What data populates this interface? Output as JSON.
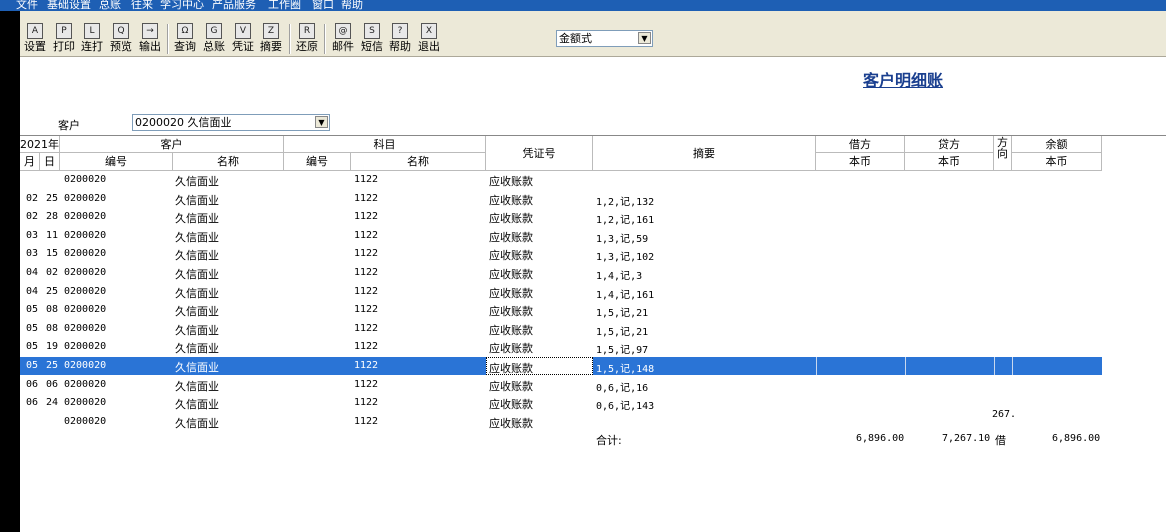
{
  "menu": [
    "文件",
    "基础设置",
    "总账",
    "往来",
    "学习中心",
    "产品服务",
    "工作圈",
    "窗口",
    "帮助"
  ],
  "toolbar": [
    {
      "label": "设置",
      "icon": "A"
    },
    {
      "label": "打印",
      "icon": "P"
    },
    {
      "label": "连打",
      "icon": "L"
    },
    {
      "label": "预览",
      "icon": "Q"
    },
    {
      "label": "输出",
      "icon": "→"
    },
    {
      "label": "查询",
      "icon": "Ω"
    },
    {
      "label": "总账",
      "icon": "G"
    },
    {
      "label": "凭证",
      "icon": "V"
    },
    {
      "label": "摘要",
      "icon": "Z"
    },
    {
      "label": "还原",
      "icon": "R"
    },
    {
      "label": "邮件",
      "icon": "@"
    },
    {
      "label": "短信",
      "icon": "S"
    },
    {
      "label": "帮助",
      "icon": "?"
    },
    {
      "label": "退出",
      "icon": "X"
    }
  ],
  "format_select": "金额式",
  "report_title": "客户明细账",
  "customer_label": "客户",
  "customer_select": "0200020  久信面业",
  "headers": {
    "year": "2021年",
    "month": "月",
    "day": "日",
    "customer": "客户",
    "cust_code": "编号",
    "cust_name": "名称",
    "subject": "科目",
    "subj_code": "编号",
    "subj_name": "名称",
    "voucher_no": "凭证号",
    "summary": "摘要",
    "debit": "借方",
    "credit": "贷方",
    "direction": "方向",
    "balance": "余额",
    "currency": "本币"
  },
  "rows": [
    {
      "m": "",
      "d": "",
      "code": "0200020",
      "name": "久信面业",
      "sc": "1122",
      "sn": "应收账款",
      "sum": ""
    },
    {
      "m": "02",
      "d": "25",
      "code": "0200020",
      "name": "久信面业",
      "sc": "1122",
      "sn": "应收账款",
      "sum": "1,2,记,132"
    },
    {
      "m": "02",
      "d": "28",
      "code": "0200020",
      "name": "久信面业",
      "sc": "1122",
      "sn": "应收账款",
      "sum": "1,2,记,161"
    },
    {
      "m": "03",
      "d": "11",
      "code": "0200020",
      "name": "久信面业",
      "sc": "1122",
      "sn": "应收账款",
      "sum": "1,3,记,59"
    },
    {
      "m": "03",
      "d": "15",
      "code": "0200020",
      "name": "久信面业",
      "sc": "1122",
      "sn": "应收账款",
      "sum": "1,3,记,102"
    },
    {
      "m": "04",
      "d": "02",
      "code": "0200020",
      "name": "久信面业",
      "sc": "1122",
      "sn": "应收账款",
      "sum": "1,4,记,3"
    },
    {
      "m": "04",
      "d": "25",
      "code": "0200020",
      "name": "久信面业",
      "sc": "1122",
      "sn": "应收账款",
      "sum": "1,4,记,161"
    },
    {
      "m": "05",
      "d": "08",
      "code": "0200020",
      "name": "久信面业",
      "sc": "1122",
      "sn": "应收账款",
      "sum": "1,5,记,21"
    },
    {
      "m": "05",
      "d": "08",
      "code": "0200020",
      "name": "久信面业",
      "sc": "1122",
      "sn": "应收账款",
      "sum": "1,5,记,21"
    },
    {
      "m": "05",
      "d": "19",
      "code": "0200020",
      "name": "久信面业",
      "sc": "1122",
      "sn": "应收账款",
      "sum": "1,5,记,97"
    },
    {
      "m": "05",
      "d": "25",
      "code": "0200020",
      "name": "久信面业",
      "sc": "1122",
      "sn": "应收账款",
      "sum": "1,5,记,148",
      "selected": true
    },
    {
      "m": "06",
      "d": "06",
      "code": "0200020",
      "name": "久信面业",
      "sc": "1122",
      "sn": "应收账款",
      "sum": "0,6,记,16"
    },
    {
      "m": "06",
      "d": "24",
      "code": "0200020",
      "name": "久信面业",
      "sc": "1122",
      "sn": "应收账款",
      "sum": "0,6,记,143"
    },
    {
      "m": "",
      "d": "",
      "code": "0200020",
      "name": "久信面业",
      "sc": "1122",
      "sn": "应收账款",
      "sum": "",
      "extra": "267."
    }
  ],
  "total": {
    "label": "合计:",
    "debit": "6,896.00",
    "credit": "7,267.10",
    "direction": "借",
    "balance": "6,896.00"
  }
}
